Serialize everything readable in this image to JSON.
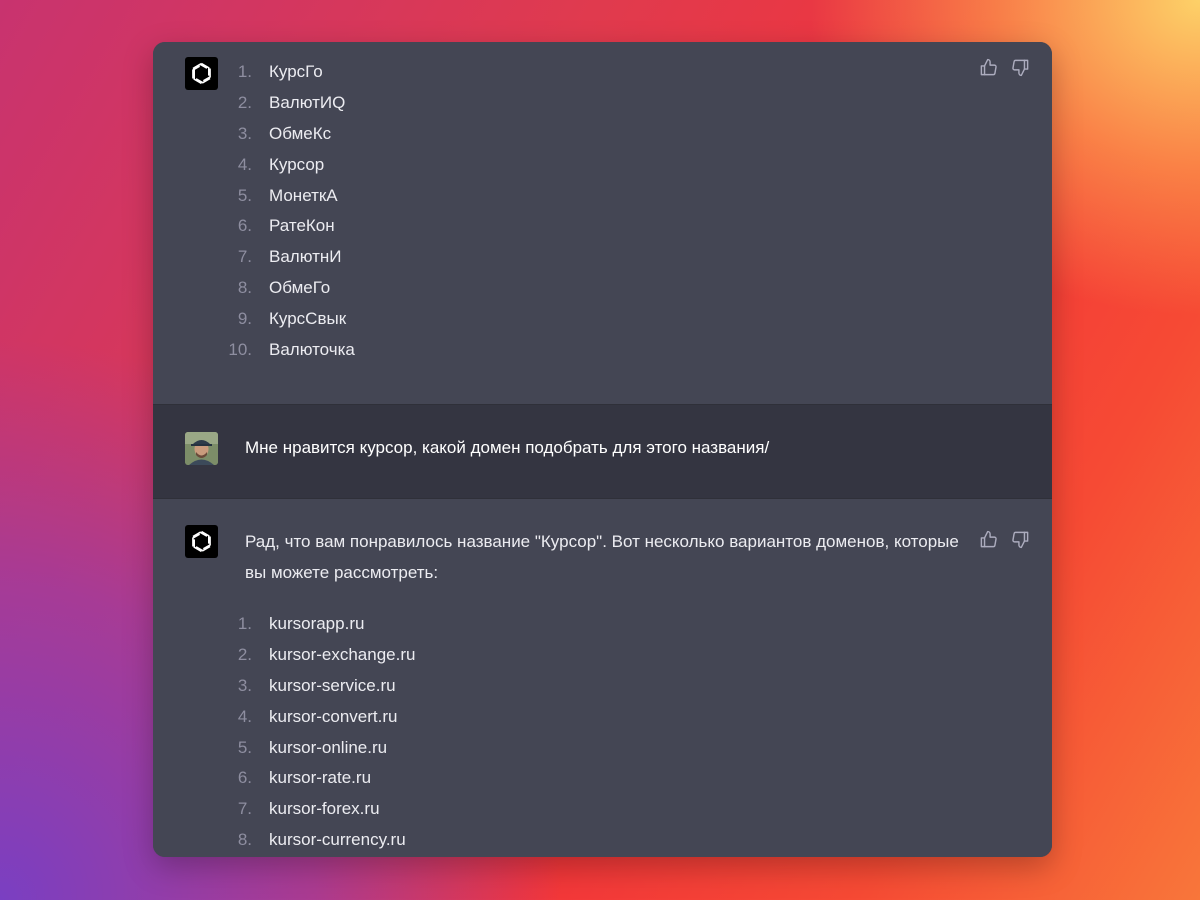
{
  "first_answer": {
    "items": [
      {
        "n": "1.",
        "text": "КурсГо"
      },
      {
        "n": "2.",
        "text": "ВалютИQ"
      },
      {
        "n": "3.",
        "text": "ОбмеКс"
      },
      {
        "n": "4.",
        "text": "Курсор"
      },
      {
        "n": "5.",
        "text": "МонеткА"
      },
      {
        "n": "6.",
        "text": "РатеКон"
      },
      {
        "n": "7.",
        "text": "ВалютнИ"
      },
      {
        "n": "8.",
        "text": "ОбмеГо"
      },
      {
        "n": "9.",
        "text": "КурсСвык"
      },
      {
        "n": "10.",
        "text": "Валюточка"
      }
    ]
  },
  "user_message": {
    "text": "Мне нравится курсор, какой домен подобрать для этого названия/"
  },
  "second_answer": {
    "intro": "Рад, что вам понравилось название \"Курсор\". Вот несколько вариантов доменов, которые вы можете рассмотреть:",
    "items": [
      {
        "n": "1.",
        "text": "kursorapp.ru"
      },
      {
        "n": "2.",
        "text": "kursor-exchange.ru"
      },
      {
        "n": "3.",
        "text": "kursor-service.ru"
      },
      {
        "n": "4.",
        "text": "kursor-convert.ru"
      },
      {
        "n": "5.",
        "text": "kursor-online.ru"
      },
      {
        "n": "6.",
        "text": "kursor-rate.ru"
      },
      {
        "n": "7.",
        "text": "kursor-forex.ru"
      },
      {
        "n": "8.",
        "text": "kursor-currency.ru"
      }
    ]
  },
  "icons": {
    "assistant_avatar": "chatgpt-logo-icon",
    "user_avatar": "user-photo",
    "like": "thumbs-up-icon",
    "dislike": "thumbs-down-icon"
  },
  "colors": {
    "assistant_bg": "#444654",
    "user_bg": "#343541",
    "text": "#ececf1",
    "number": "#8e8ea0",
    "icon": "#acacbe"
  }
}
